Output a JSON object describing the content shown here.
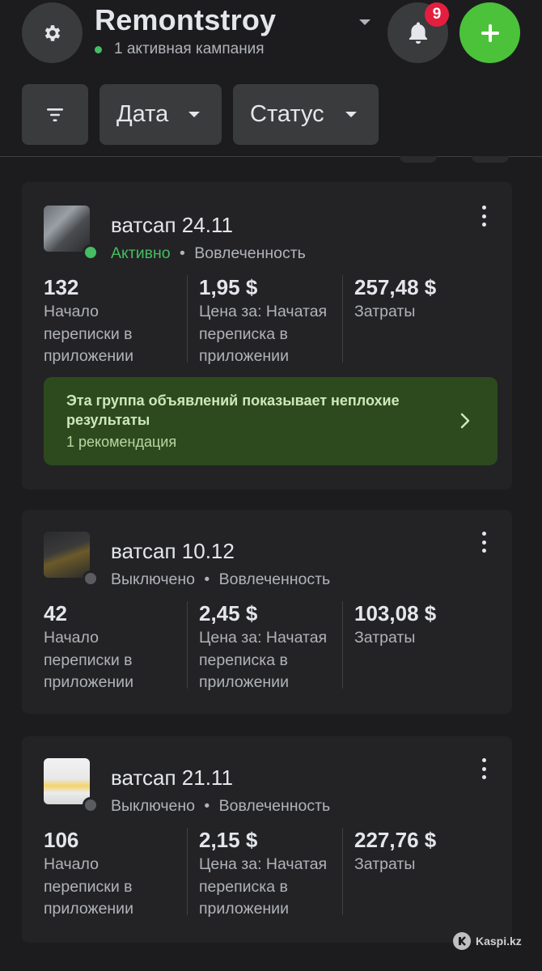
{
  "header": {
    "account_name": "Remontstroy",
    "account_status": "1 активная кампания",
    "notification_count": "9"
  },
  "filters": {
    "date_label": "Дата",
    "status_label": "Статус"
  },
  "adsets": [
    {
      "name": "ватсап 24.11",
      "status": "Активно",
      "separator": "•",
      "objective": "Вовлеченность",
      "metrics": [
        {
          "value": "132",
          "label": "Начало переписки в приложении"
        },
        {
          "value": "1,95 $",
          "label": "Цена за: Начатая переписка в приложении"
        },
        {
          "value": "257,48 $",
          "label": "Затраты"
        }
      ],
      "recommendation": {
        "title": "Эта группа объявлений показывает неплохие результаты",
        "subtitle": "1 рекомендация"
      }
    },
    {
      "name": "ватсап 10.12",
      "status": "Выключено",
      "separator": "•",
      "objective": "Вовлеченность",
      "metrics": [
        {
          "value": "42",
          "label": "Начало переписки в приложении"
        },
        {
          "value": "2,45 $",
          "label": "Цена за: Начатая переписка в приложении"
        },
        {
          "value": "103,08 $",
          "label": "Затраты"
        }
      ]
    },
    {
      "name": "ватсап 21.11",
      "status": "Выключено",
      "separator": "•",
      "objective": "Вовлеченность",
      "metrics": [
        {
          "value": "106",
          "label": "Начало переписки в приложении"
        },
        {
          "value": "2,15 $",
          "label": "Цена за: Начатая переписка в приложении"
        },
        {
          "value": "227,76 $",
          "label": "Затраты"
        }
      ]
    }
  ],
  "watermark": "Kaspi.kz",
  "colors": {
    "background": "#1c1c1e",
    "card": "#232325",
    "button": "#3a3b3c",
    "accent_green": "#4cc23a",
    "active_status": "#45bd62",
    "badge_red": "#e41e3f",
    "recommendation_bg": "#2d4a1f"
  }
}
